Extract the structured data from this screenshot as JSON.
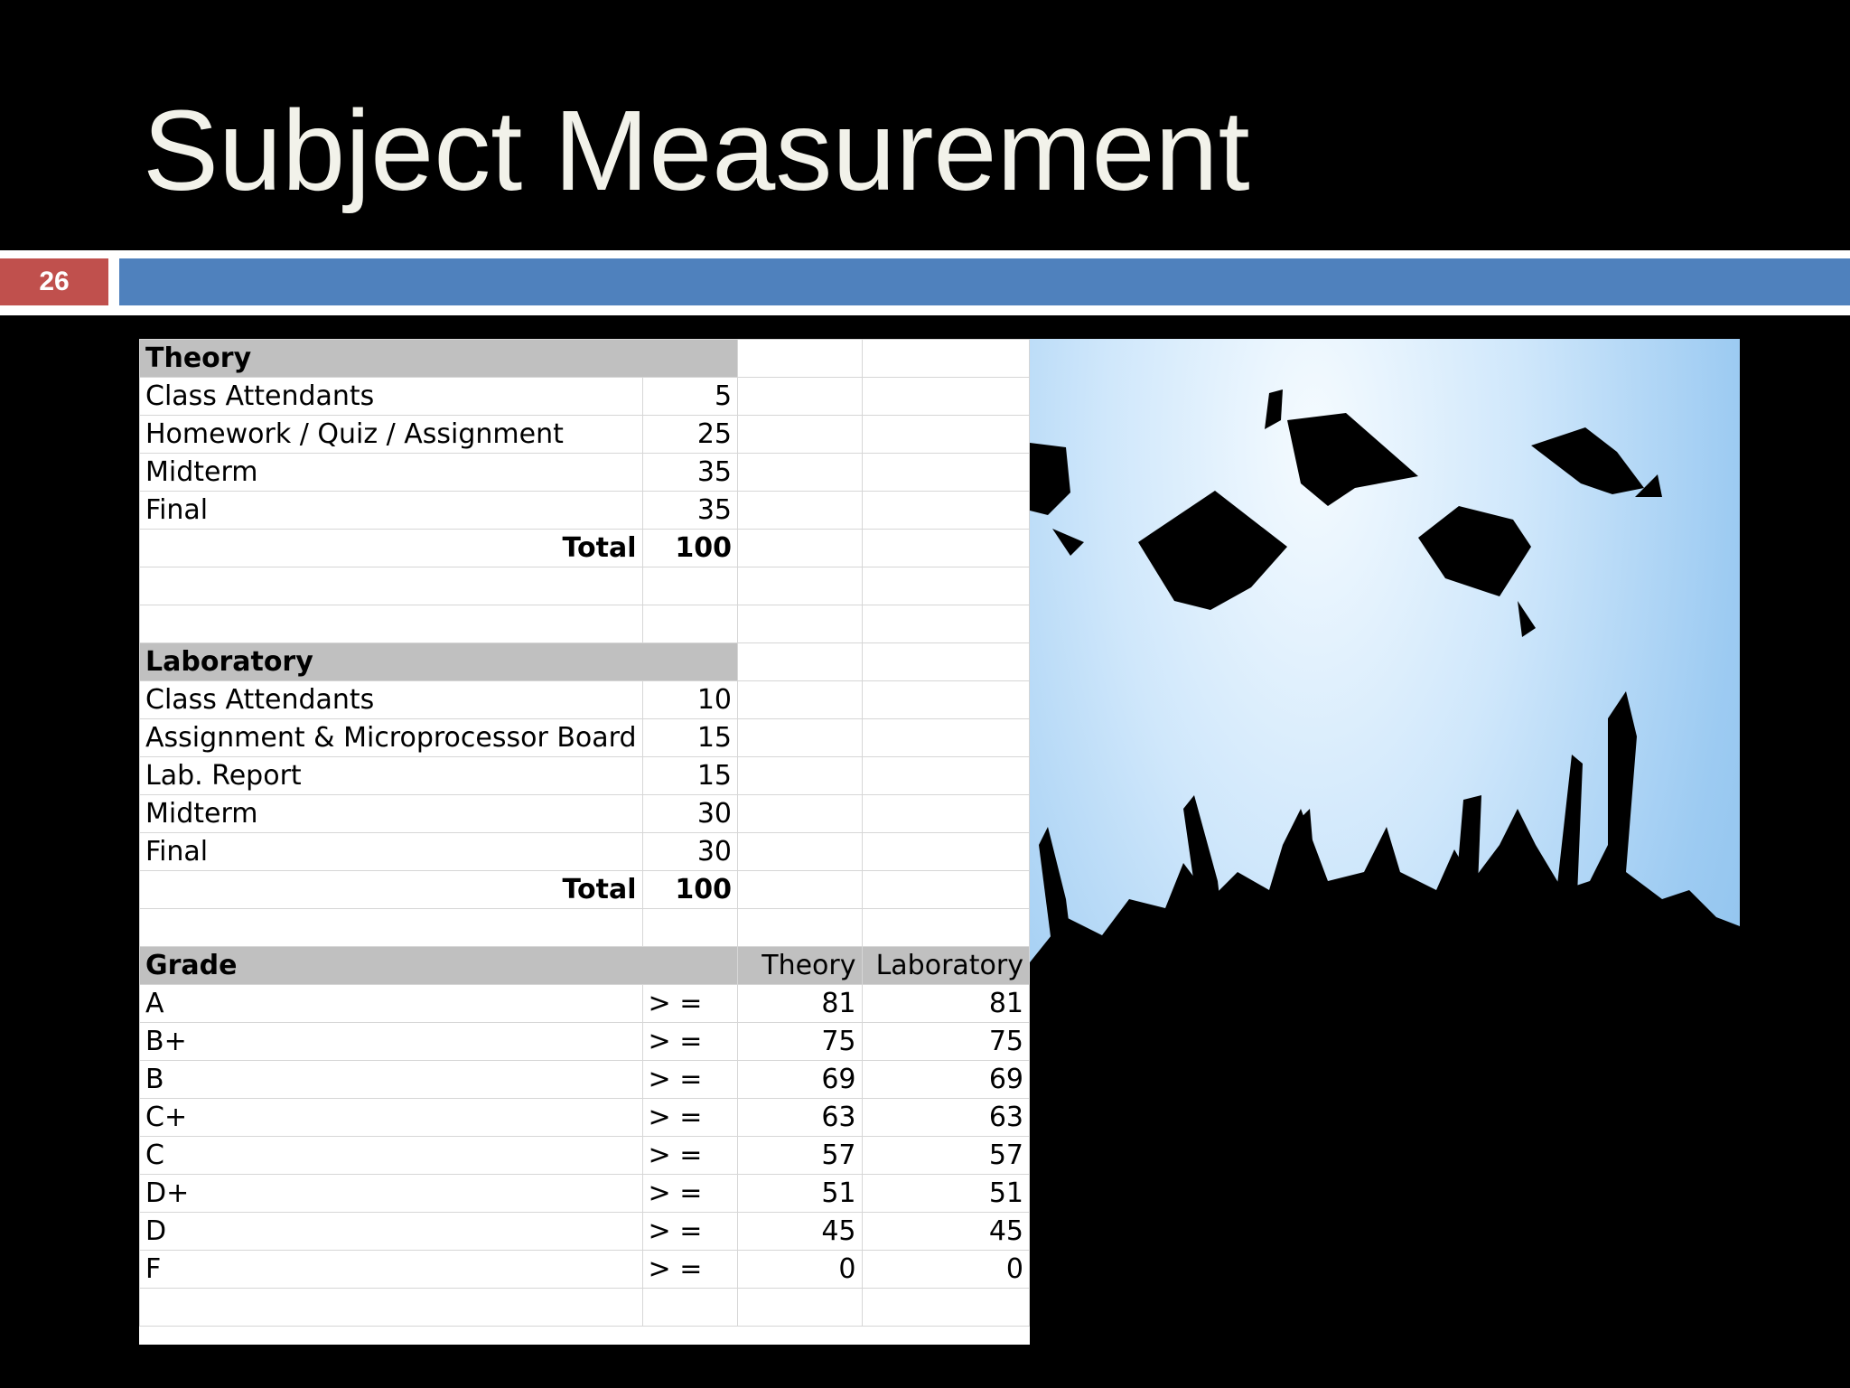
{
  "slide": {
    "title": "Subject Measurement",
    "number": "26"
  },
  "theory": {
    "header": "Theory",
    "items": [
      {
        "label": "Class Attendants",
        "value": "5"
      },
      {
        "label": "Homework / Quiz / Assignment",
        "value": "25"
      },
      {
        "label": "Midterm",
        "value": "35"
      },
      {
        "label": "Final",
        "value": "35"
      }
    ],
    "total_label": "Total",
    "total_value": "100"
  },
  "laboratory": {
    "header": "Laboratory",
    "items": [
      {
        "label": "Class Attendants",
        "value": "10"
      },
      {
        "label": "Assignment & Microprocessor Board",
        "value": "15"
      },
      {
        "label": "Lab. Report",
        "value": "15"
      },
      {
        "label": "Midterm",
        "value": "30"
      },
      {
        "label": "Final",
        "value": "30"
      }
    ],
    "total_label": "Total",
    "total_value": "100"
  },
  "grades": {
    "header": "Grade",
    "theory_header": "Theory",
    "lab_header": "Laboratory",
    "operator": "> =",
    "rows": [
      {
        "grade": "A",
        "theory": "81",
        "lab": "81"
      },
      {
        "grade": "B+",
        "theory": "75",
        "lab": "75"
      },
      {
        "grade": "B",
        "theory": "69",
        "lab": "69"
      },
      {
        "grade": "C+",
        "theory": "63",
        "lab": "63"
      },
      {
        "grade": "C",
        "theory": "57",
        "lab": "57"
      },
      {
        "grade": "D+",
        "theory": "51",
        "lab": "51"
      },
      {
        "grade": "D",
        "theory": "45",
        "lab": "45"
      },
      {
        "grade": "F",
        "theory": "0",
        "lab": "0"
      }
    ]
  },
  "colors": {
    "title": "#f2f2ea",
    "slide_number_bg": "#c0504d",
    "bar": "#4f81bd",
    "theory_text": "#1fa04a",
    "lab_text": "#e5731b",
    "header_fill": "#c0c0c0"
  },
  "image": {
    "subject": "graduation-caps-silhouette"
  }
}
